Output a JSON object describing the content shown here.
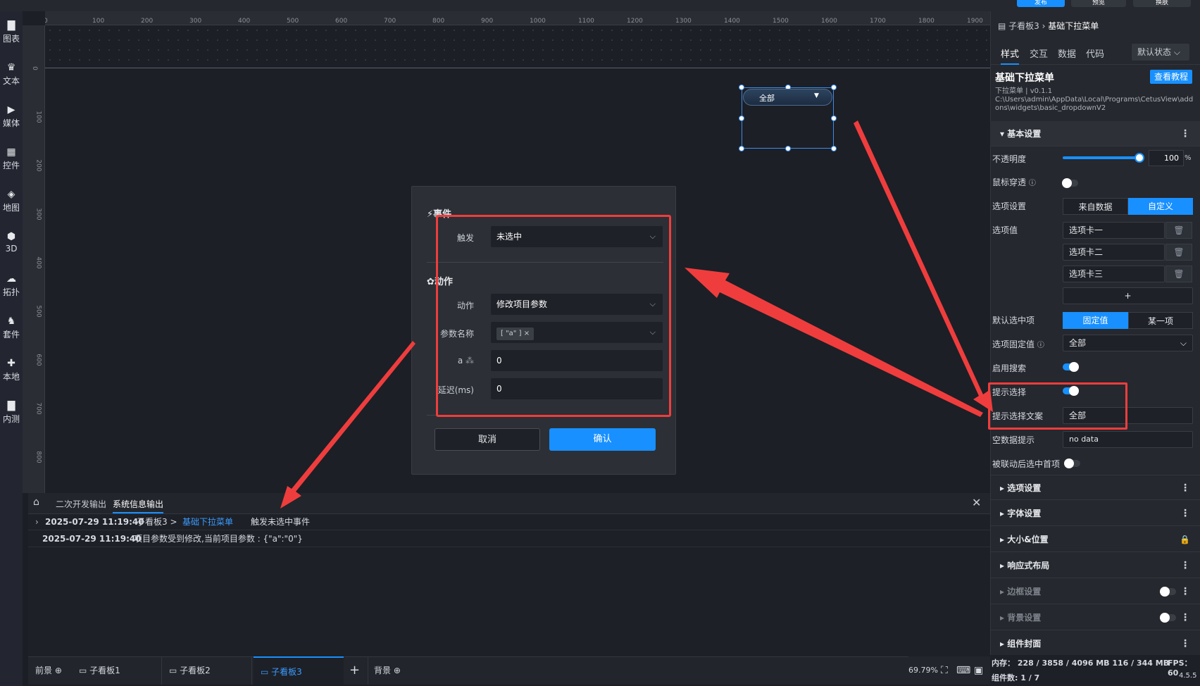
{
  "top": {
    "publish_label": "发布",
    "preview_label": "预览",
    "theme_label": "换肤"
  },
  "tools": [
    {
      "icon": "bar-chart-icon",
      "label": "图表"
    },
    {
      "icon": "text-icon",
      "label": "文本"
    },
    {
      "icon": "media-icon",
      "label": "媒体"
    },
    {
      "icon": "controls-icon",
      "label": "控件"
    },
    {
      "icon": "map-icon",
      "label": "地图"
    },
    {
      "icon": "cube-icon",
      "label": "3D"
    },
    {
      "icon": "topology-icon",
      "label": "拓扑"
    },
    {
      "icon": "kit-icon",
      "label": "套件"
    },
    {
      "icon": "puzzle-icon",
      "label": "本地"
    },
    {
      "icon": "beta-icon",
      "label": "内测"
    }
  ],
  "ruler": {
    "x_labels": [
      "0",
      "100",
      "200",
      "300",
      "400",
      "500",
      "600",
      "700",
      "800",
      "900",
      "1000",
      "1100",
      "1200",
      "1300",
      "1400",
      "1500",
      "1600",
      "1700",
      "1800",
      "1900"
    ],
    "y_labels": [
      "0",
      "100",
      "200",
      "300",
      "400",
      "500",
      "600",
      "700",
      "800"
    ]
  },
  "widget": {
    "label": "全部"
  },
  "modal": {
    "event_title": "事件",
    "trigger_label": "触发",
    "trigger_value": "未选中",
    "action_title": "动作",
    "action_label": "动作",
    "action_value": "修改项目参数",
    "param_name_label": "参数名称",
    "param_tag": "[ \"a\" ]",
    "a_label": "a",
    "a_value": "0",
    "delay_label": "延迟(ms)",
    "delay_value": "0",
    "cancel_label": "取消",
    "confirm_label": "确认"
  },
  "console": {
    "tab_dev": "二次开发输出",
    "tab_sys": "系统信息输出",
    "rows": [
      {
        "time": "2025-07-29 11:19:40",
        "prefix": "子看板3 >",
        "link": "基础下拉菜单",
        "msg": "触发未选中事件"
      },
      {
        "time": "2025-07-29 11:19:40",
        "prefix": "",
        "link": "",
        "msg": "项目参数受到修改,当前项目参数 : {\"a\":\"0\"}"
      }
    ]
  },
  "bottom": {
    "foreground": "前景",
    "board1": "子看板1",
    "board2": "子看板2",
    "board3": "子看板3",
    "background": "背景",
    "zoom": "69.79%"
  },
  "panel": {
    "breadcrumb_parent": "子看板3",
    "breadcrumb_current": "基础下拉菜单",
    "tabs": [
      "样式",
      "交互",
      "数据",
      "代码"
    ],
    "state": "默认状态",
    "title": "基础下拉菜单",
    "tutorial": "查看教程",
    "version": "下拉菜单 | v0.1.1",
    "path": "C:\\Users\\admin\\AppData\\Local\\Programs\\CetusView\\addons\\widgets\\basic_dropdownV2",
    "basic_section": "基本设置",
    "opacity_label": "不透明度",
    "opacity_value": "100",
    "opacity_unit": "%",
    "opacity_fraction": 1.0,
    "mouse_through_label": "鼠标穿透",
    "options_setting_label": "选项设置",
    "from_data": "来自数据",
    "custom": "自定义",
    "options_value_label": "选项值",
    "options": [
      "选项卡一",
      "选项卡二",
      "选项卡三"
    ],
    "add": "+",
    "default_selected_label": "默认选中项",
    "fixed_value": "固定值",
    "some_item": "某一项",
    "fixed_option_label": "选项固定值",
    "fixed_option_value": "全部",
    "enable_search_label": "启用搜索",
    "prompt_select_label": "提示选择",
    "prompt_text_label": "提示选择文案",
    "prompt_text_value": "全部",
    "empty_hint_label": "空数据提示",
    "empty_hint_value": "no data",
    "linked_first_label": "被联动后选中首项",
    "sections": [
      "选项设置",
      "字体设置",
      "大小&位置",
      "响应式布局",
      "边框设置",
      "背景设置",
      "组件封面"
    ],
    "memory": "内存： 228 / 3858 / 4096 MB  116 / 344 MB",
    "fps": "FPS： 60",
    "components": "组件数: 1 / 7",
    "app_version": "4.5.5"
  },
  "colors": {
    "accent": "#1890ff",
    "highlight": "#ef3d3d"
  }
}
